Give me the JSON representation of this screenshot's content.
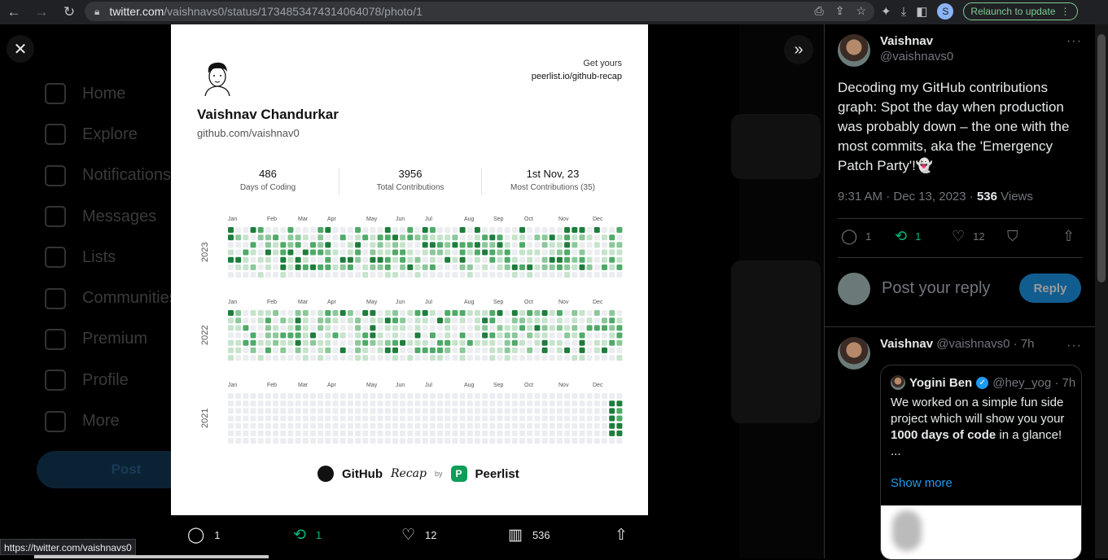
{
  "browser": {
    "url_host": "twitter.com",
    "url_path": "/vaishnavs0/status/1734853474314064078/photo/1",
    "profile_initial": "S",
    "relaunch_label": "Relaunch to update"
  },
  "status_bar_url": "https://twitter.com/vaishnavs0",
  "background_nav": [
    "Home",
    "Explore",
    "Notifications",
    "Messages",
    "Lists",
    "Communities",
    "Premium",
    "Profile",
    "More"
  ],
  "background_post_label": "Post",
  "image_card": {
    "get_yours_label": "Get yours",
    "get_yours_url": "peerlist.io/github-recap",
    "name": "Vaishnav Chandurkar",
    "github_url": "github.com/vaishnav0",
    "stats": [
      {
        "value": "486",
        "label": "Days of Coding"
      },
      {
        "value": "3956",
        "label": "Total Contributions"
      },
      {
        "value": "1st Nov, 23",
        "label": "Most Contributions (35)"
      }
    ],
    "months": [
      "Jan",
      "Feb",
      "Mar",
      "Apr",
      "May",
      "Jun",
      "Jul",
      "Aug",
      "Sep",
      "Oct",
      "Nov",
      "Dec"
    ],
    "years": [
      "2023",
      "2022",
      "2021"
    ],
    "footer": {
      "github": "GitHub",
      "recap": "Recap",
      "by": "by",
      "peerlist": "Peerlist",
      "peerlist_initial": "P"
    },
    "colors": {
      "empty": "#ebedf0",
      "l1": "#c6e3cb",
      "l2": "#8cc79a",
      "l3": "#4faa68",
      "l4": "#1e7d3c"
    }
  },
  "photo_actions": {
    "replies": "1",
    "reposts": "1",
    "likes": "12",
    "views": "536"
  },
  "tweet": {
    "author_name": "Vaishnav",
    "author_handle": "@vaishnavs0",
    "text": "Decoding my GitHub contributions graph: Spot the day when production was probably down – the one with the most commits, aka the 'Emergency Patch Party'!👻",
    "time": "9:31 AM · Dec 13, 2023 ·",
    "views_count": "536",
    "views_label": "Views",
    "replies": "1",
    "reposts": "1",
    "likes": "12",
    "reply_placeholder": "Post your reply",
    "reply_button": "Reply"
  },
  "reply": {
    "author_name": "Vaishnav",
    "author_handle": "@vaishnavs0 · 7h",
    "quote": {
      "name": "Yogini Ben",
      "handle": "@hey_yog · 7h",
      "text_before": "We worked on a simple fun side project which will show you your ",
      "text_bold": "1000 days of code",
      "text_after": " in a glance!",
      "ellipsis": "...",
      "show_more": "Show more"
    }
  }
}
